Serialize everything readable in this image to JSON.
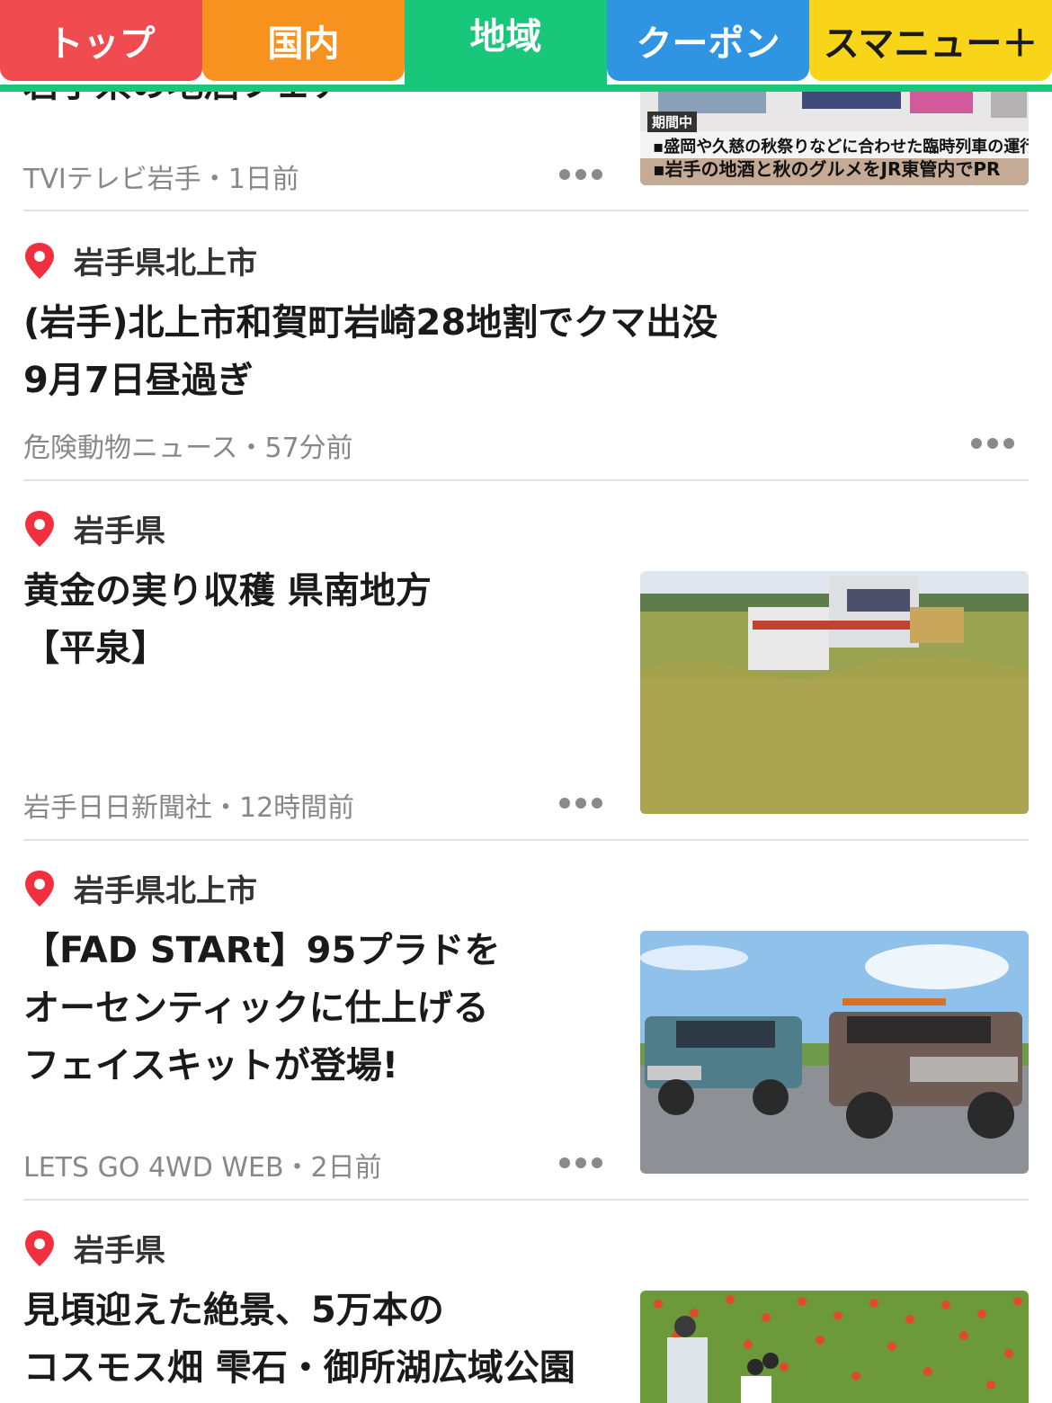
{
  "tabs": [
    {
      "label": "トップ",
      "color": "#f04b4e"
    },
    {
      "label": "国内",
      "color": "#f7921e"
    },
    {
      "label": "地域",
      "color": "#19c77a"
    },
    {
      "label": "クーポン",
      "color": "#2f95e3"
    },
    {
      "label": "スマニュー＋",
      "color": "#f9d51a"
    }
  ],
  "articles": [
    {
      "headline_partial": "岩手県の地酒フェア",
      "source": "TVIテレビ岩手・1日前",
      "thumb_captions": [
        "期間中",
        "盛岡や久慈の秋祭りなどに合わせた臨時列車の運行",
        "岩手の地酒と秋のグルメをJR東管内でPR"
      ]
    },
    {
      "location": "岩手県北上市",
      "headline": [
        "(岩手)北上市和賀町岩崎28地割でクマ出没",
        "9月7日昼過ぎ"
      ],
      "source": "危険動物ニュース・57分前"
    },
    {
      "location": "岩手県",
      "headline": [
        "黄金の実り収穫 県南地方",
        "【平泉】"
      ],
      "source": "岩手日日新聞社・12時間前"
    },
    {
      "location": "岩手県北上市",
      "headline": [
        "【FAD STARt】95プラドを",
        "オーセンティックに仕上げる",
        "フェイスキットが登場!"
      ],
      "source": "LETS GO 4WD WEB・2日前"
    },
    {
      "location": "岩手県",
      "headline": [
        "見頃迎えた絶景、5万本の",
        "コスモス畑 雫石・御所湖広域公園"
      ]
    }
  ]
}
